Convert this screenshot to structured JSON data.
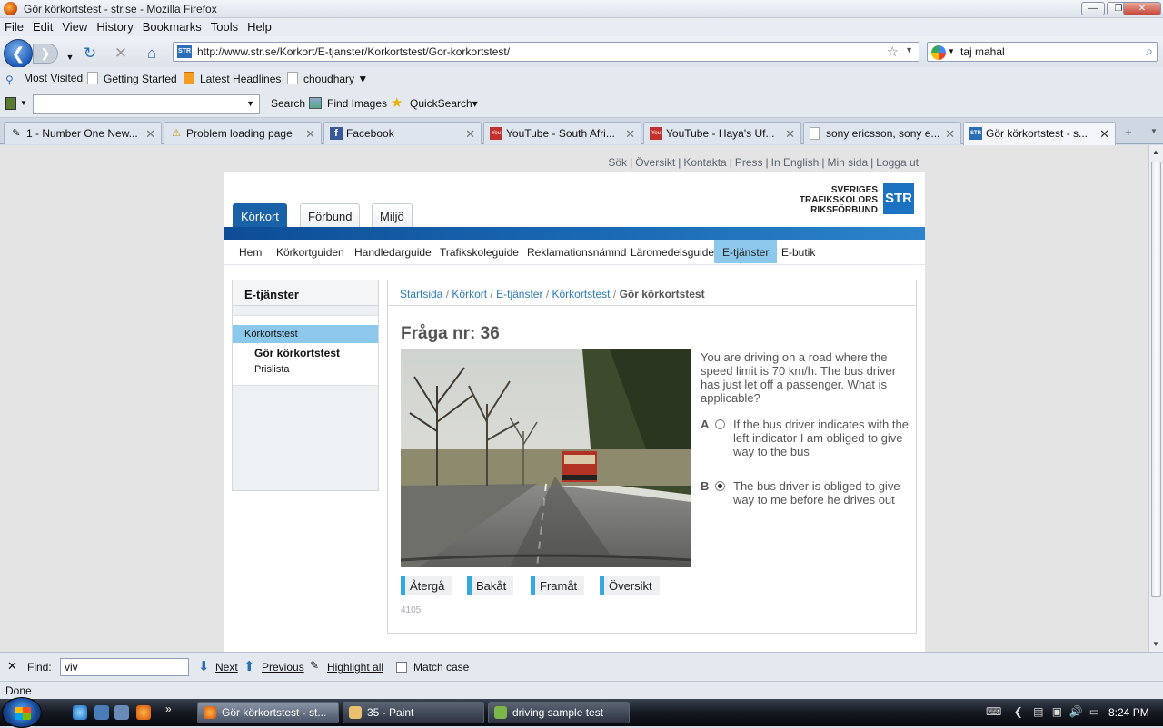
{
  "window": {
    "title": "Gör körkortstest - str.se - Mozilla Firefox"
  },
  "menu": [
    "File",
    "Edit",
    "View",
    "History",
    "Bookmarks",
    "Tools",
    "Help"
  ],
  "nav": {
    "url": "http://www.str.se/Korkort/E-tjanster/Korkortstest/Gor-korkortstest/",
    "favicon_text": "STR",
    "search_value": "taj mahal"
  },
  "bookmarks": [
    "Most Visited",
    "Getting Started",
    "Latest Headlines",
    "choudhary ▼"
  ],
  "toolbar2": {
    "search": "Search",
    "find_images": "Find Images",
    "quicksearch": "QuickSearch▾"
  },
  "tabs": [
    {
      "label": "1 - Number One New...",
      "icon": "tool-icon"
    },
    {
      "label": "Problem loading page",
      "icon": "warning-icon"
    },
    {
      "label": "Facebook",
      "icon": "facebook-icon"
    },
    {
      "label": "YouTube - South Afri...",
      "icon": "youtube-icon"
    },
    {
      "label": "YouTube - Haya's Uf...",
      "icon": "youtube-icon"
    },
    {
      "label": "sony ericsson, sony e...",
      "icon": "page-icon"
    },
    {
      "label": "Gör körkortstest - s...",
      "icon": "str-icon"
    }
  ],
  "site": {
    "toplinks": [
      "Sök",
      "Översikt",
      "Kontakta",
      "Press",
      "In English",
      "Min sida",
      "Logga ut"
    ],
    "header_tabs": [
      "Körkort",
      "Förbund",
      "Miljö"
    ],
    "logo_lines": [
      "SVERIGES",
      "TRAFIKSKOLORS",
      "RIKSFÖRBUND"
    ],
    "logo_badge": "STR",
    "subnav": [
      "Hem",
      "Körkortguiden",
      "Handledarguide",
      "Trafikskoleguide",
      "Reklamationsnämnd",
      "Läromedelsguide",
      "E-tjänster",
      "E-butik"
    ],
    "sidebar": {
      "heading": "E-tjänster",
      "item_active": "Körkortstest",
      "sub_current": "Gör körkortstest",
      "sub_other": "Prislista"
    },
    "breadcrumb": [
      "Startsida",
      "Körkort",
      "E-tjänster",
      "Körkortstest"
    ],
    "breadcrumb_sep": "/",
    "breadcrumb_current": "Gör körkortstest",
    "question": {
      "title": "Fråga nr: 36",
      "text": "You are driving on a road where the speed limit is 70 km/h. The bus driver has just let off a passenger. What is applicable?",
      "options": [
        {
          "letter": "A",
          "text": "If the bus driver indicates with the left indicator I am obliged to give way to the bus",
          "selected": false
        },
        {
          "letter": "B",
          "text": "The bus driver is obliged to give way to me before he drives out",
          "selected": true
        }
      ],
      "buttons": [
        "Återgå",
        "Bakåt",
        "Framåt",
        "Översikt"
      ],
      "id": "4105"
    }
  },
  "findbar": {
    "label": "Find:",
    "value": "viv",
    "next": "Next",
    "previous": "Previous",
    "highlight": "Highlight all",
    "matchcase": "Match case"
  },
  "status": "Done",
  "taskbar": {
    "items": [
      "Gör körkortstest - st...",
      "35 - Paint",
      "driving sample test"
    ],
    "clock": "8:24 PM"
  }
}
